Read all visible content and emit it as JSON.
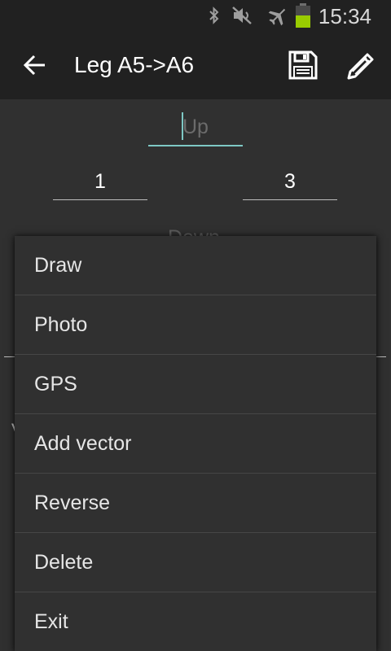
{
  "status_bar": {
    "time": "15:34",
    "icons": [
      "bluetooth-icon",
      "mute-icon",
      "airplane-icon",
      "battery-icon"
    ],
    "battery_color": "#99cc00"
  },
  "toolbar": {
    "title": "Leg A5->A6",
    "icons": [
      "back-arrow-icon",
      "save-icon",
      "edit-pencil-icon"
    ]
  },
  "form": {
    "up_placeholder": "Up",
    "from_value": "1",
    "to_value": "3",
    "down_label": "Down",
    "accent_color": "#7ec8c4"
  },
  "menu": {
    "items": [
      "Draw",
      "Photo",
      "GPS",
      "Add vector",
      "Reverse",
      "Delete",
      "Exit"
    ]
  }
}
